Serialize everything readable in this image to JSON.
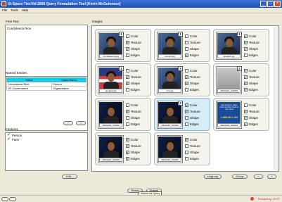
{
  "window": {
    "title": "UI-Space TrecVid 2006 Query Formulation Tool [Kevin McGuinness]"
  },
  "menu": [
    "File",
    "Tools",
    "Help"
  ],
  "left": {
    "free_text_label": "Free Text",
    "free_text_value": "Condoleeza Rice",
    "named_entities_label": "Named Entities",
    "named_entities": {
      "columns": [
        "Value",
        "Class Name"
      ],
      "rows": [
        [
          "Condoleeza Rice",
          "Person"
        ],
        [
          "US Government",
          "Organization"
        ]
      ]
    },
    "minus_label": "−",
    "plus_label": "+",
    "features_label": "Features",
    "features": [
      "Person",
      "Face"
    ],
    "edit_label": "Edit..."
  },
  "images_label": "Images",
  "option_labels": [
    "Color",
    "Texture",
    "Shape",
    "Edges"
  ],
  "cards": [
    {
      "caption": "Condoleezza.jpg",
      "rank": "1",
      "checks": [
        false,
        true,
        true,
        false
      ],
      "style": "photo"
    },
    {
      "caption": "condo1.jpg",
      "rank": "1",
      "checks": [
        false,
        false,
        false,
        true
      ],
      "style": "photo"
    },
    {
      "caption": "google1.jpg",
      "rank": "1",
      "checks": [
        true,
        true,
        true,
        false
      ],
      "style": "photo"
    },
    {
      "caption": "google3.jpg",
      "rank": "1",
      "checks": [
        false,
        true,
        true,
        false
      ],
      "style": "flag"
    },
    {
      "caption": "rice.jpg",
      "rank": "2",
      "checks": [
        false,
        true,
        true,
        false
      ],
      "style": "photo"
    },
    {
      "caption": "20041112_110000",
      "rank": "2",
      "checks": [
        true,
        true,
        true,
        true
      ],
      "style": "grey"
    },
    {
      "caption": "20041116_110000",
      "rank": "",
      "checks": [
        false,
        true,
        false,
        false
      ],
      "style": "dark"
    },
    {
      "caption": "20041116_160000",
      "rank": "2",
      "checks": [
        true,
        true,
        false,
        false
      ],
      "style": "dark",
      "selected": true
    },
    {
      "caption": "20041116_220000",
      "rank": "",
      "checks": [
        false,
        true,
        true,
        true
      ],
      "style": "doc",
      "doc_text": "Iraqi elections: Share what you think. Send us your views",
      "doc_phone": "1-888-30-1-144"
    },
    {
      "caption": "20041116_190000",
      "rank": "",
      "checks": [
        true,
        true,
        true,
        true
      ],
      "style": "dark"
    },
    {
      "caption": "20041116_230000",
      "rank": "",
      "checks": [
        true,
        false,
        false,
        false
      ],
      "style": "dark"
    }
  ],
  "image_buttons": {
    "ungroup": "Ungroup",
    "group": "Group",
    "minus": "−",
    "plus": "+"
  },
  "actions": {
    "reset": "Reset",
    "submit": "Submit"
  },
  "tooltip": "Submit the Query",
  "status": {
    "remaining": "Remaining: 00:57"
  }
}
